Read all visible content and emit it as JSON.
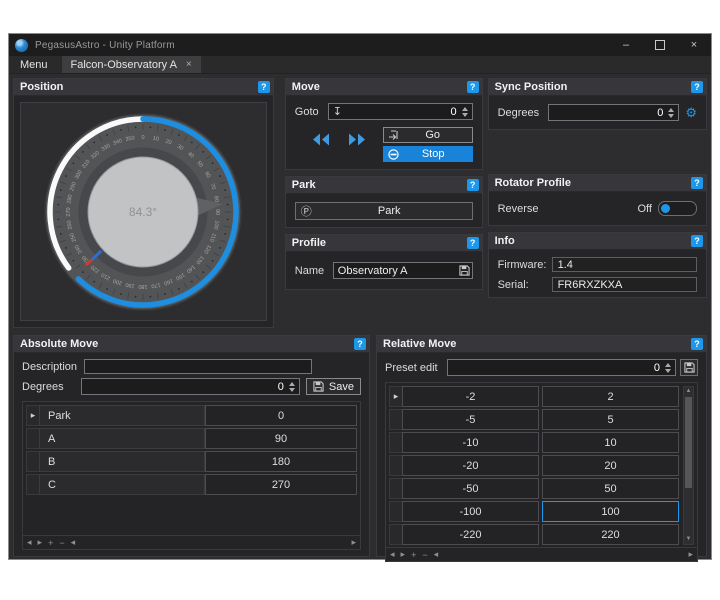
{
  "window": {
    "title": "PegasusAstro - Unity Platform",
    "controls": {
      "minimize": "–",
      "close": "×"
    }
  },
  "tabs": {
    "menu": "Menu",
    "active_tab": "Falcon-Observatory A",
    "close": "×"
  },
  "icons": {
    "help": "?",
    "gear": "⚙",
    "park_circle": "Ⓟ",
    "goto_download": "↧",
    "row_selector": "▸",
    "nav_prev": "◂",
    "nav_next": "▸",
    "nav_add": "+",
    "nav_remove": "−",
    "scroll_up": "▲",
    "scroll_down": "▼"
  },
  "colors": {
    "accent": "#1c97ea",
    "stop_button": "#1883d8",
    "dial_blue_arc": "#1e8fe0",
    "dial_white_arc": "#fafafa"
  },
  "position": {
    "title": "Position",
    "dial": {
      "display": "84.3°",
      "current_deg": 84.3,
      "blue_arc_deg": [
        0,
        224
      ],
      "white_arc_deg": [
        233,
        360
      ],
      "marker_deg": 227,
      "tick_label_step_deg": 10
    }
  },
  "move": {
    "title": "Move",
    "goto_label": "Goto",
    "goto_value": "0",
    "go_label": "Go",
    "stop_label": "Stop"
  },
  "sync": {
    "title": "Sync Position",
    "degrees_label": "Degrees",
    "degrees_value": "0"
  },
  "park": {
    "title": "Park",
    "button_label": "Park"
  },
  "rotator_profile": {
    "title": "Rotator Profile",
    "reverse_label": "Reverse",
    "state": "Off"
  },
  "profile": {
    "title": "Profile",
    "name_label": "Name",
    "name_value": "Observatory A"
  },
  "info": {
    "title": "Info",
    "firmware_label": "Firmware:",
    "firmware_value": "1.4",
    "serial_label": "Serial:",
    "serial_value": "FR6RXZKXA"
  },
  "absolute": {
    "title": "Absolute Move",
    "description_label": "Description",
    "description_value": "",
    "degrees_label": "Degrees",
    "degrees_value": "0",
    "save_label": "Save",
    "active_row": 0,
    "rows": [
      {
        "name": "Park",
        "value": "0"
      },
      {
        "name": "A",
        "value": "90"
      },
      {
        "name": "B",
        "value": "180"
      },
      {
        "name": "C",
        "value": "270"
      }
    ]
  },
  "relative": {
    "title": "Relative Move",
    "preset_label": "Preset edit",
    "preset_value": "0",
    "active_row": 0,
    "selected_cell": {
      "row": 5,
      "col": 1
    },
    "rows": [
      [
        "-2",
        "2"
      ],
      [
        "-5",
        "5"
      ],
      [
        "-10",
        "10"
      ],
      [
        "-20",
        "20"
      ],
      [
        "-50",
        "50"
      ],
      [
        "-100",
        "100"
      ],
      [
        "-220",
        "220"
      ]
    ]
  }
}
